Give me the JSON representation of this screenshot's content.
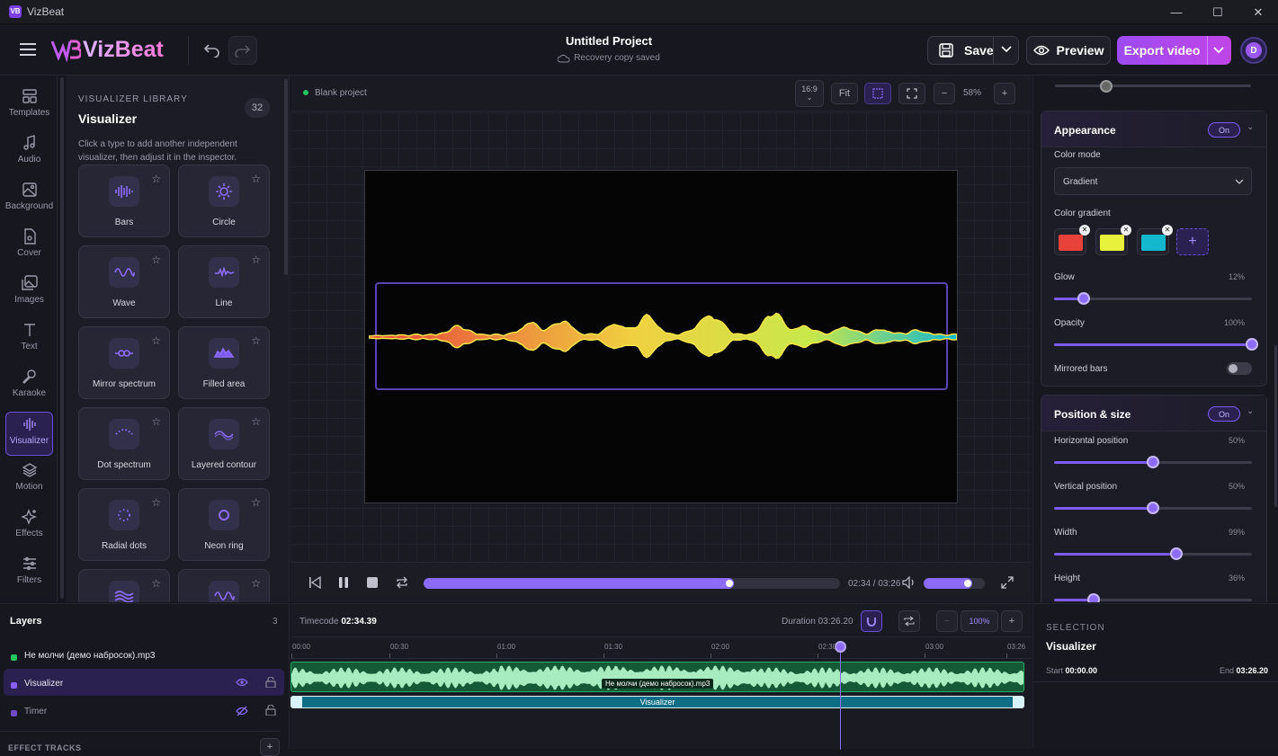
{
  "window": {
    "title": "VizBeat",
    "logo_text": "VB"
  },
  "header": {
    "brand": "VizBeat",
    "project_title": "Untitled Project",
    "project_status": "Recovery copy saved",
    "save_label": "Save",
    "preview_label": "Preview",
    "export_label": "Export video",
    "avatar_initial": "D"
  },
  "rail": {
    "items": [
      {
        "label": "Templates",
        "icon": "templates-icon"
      },
      {
        "label": "Audio",
        "icon": "music-note-icon"
      },
      {
        "label": "Background",
        "icon": "image-icon"
      },
      {
        "label": "Cover",
        "icon": "cover-icon"
      },
      {
        "label": "Images",
        "icon": "images-icon"
      },
      {
        "label": "Text",
        "icon": "text-icon"
      },
      {
        "label": "Karaoke",
        "icon": "microphone-icon"
      },
      {
        "label": "Visualizer",
        "icon": "waveform-icon",
        "active": true
      },
      {
        "label": "Motion",
        "icon": "layers-icon"
      },
      {
        "label": "Effects",
        "icon": "sparkle-icon"
      },
      {
        "label": "Filters",
        "icon": "sliders-icon"
      }
    ]
  },
  "library": {
    "kicker": "VISUALIZER LIBRARY",
    "title": "Visualizer",
    "count": "32",
    "hint": "Click a type to add another independent visualizer, then adjust it in the inspector.",
    "cards": [
      {
        "label": "Bars",
        "icon": "bars-icon"
      },
      {
        "label": "Circle",
        "icon": "sun-icon"
      },
      {
        "label": "Wave",
        "icon": "wave-icon"
      },
      {
        "label": "Line",
        "icon": "line-wave-icon"
      },
      {
        "label": "Mirror spectrum",
        "icon": "mirror-icon"
      },
      {
        "label": "Filled area",
        "icon": "area-icon"
      },
      {
        "label": "Dot spectrum",
        "icon": "dots-arc-icon"
      },
      {
        "label": "Layered contour",
        "icon": "contour-icon"
      },
      {
        "label": "Radial dots",
        "icon": "radial-dots-icon"
      },
      {
        "label": "Neon ring",
        "icon": "ring-icon"
      },
      {
        "label": "",
        "icon": "stacked-wave-icon"
      },
      {
        "label": "",
        "icon": "wave-icon"
      }
    ]
  },
  "stage": {
    "project_label": "Blank project",
    "aspect": "16:9",
    "fit_label": "Fit",
    "zoom": "58%"
  },
  "player": {
    "time_display": "02:34 / 03:26",
    "progress": 0.745,
    "volume": 0.8
  },
  "inspector": {
    "appearance": {
      "title": "Appearance",
      "toggle": "On",
      "color_mode_label": "Color mode",
      "color_mode_value": "Gradient",
      "gradient_label": "Color gradient",
      "colors": [
        "#e8423a",
        "#e8f23c",
        "#13b8cf"
      ],
      "glow_label": "Glow",
      "glow_value": "12%",
      "glow": 0.12,
      "opacity_label": "Opacity",
      "opacity_value": "100%",
      "opacity": 1.0,
      "mirrored_label": "Mirrored bars"
    },
    "position": {
      "title": "Position & size",
      "toggle": "On",
      "h_label": "Horizontal position",
      "h_value": "50%",
      "h": 0.5,
      "v_label": "Vertical position",
      "v_value": "50%",
      "v": 0.5,
      "w_label": "Width",
      "w_value": "99%",
      "w": 0.62,
      "ht_label": "Height",
      "ht_value": "36%",
      "ht": 0.2
    }
  },
  "layers": {
    "title": "Layers",
    "count": "3",
    "items": [
      {
        "name": "Не молчи (демо набросок).mp3",
        "color": "#22c55e"
      },
      {
        "name": "Visualizer",
        "color": "#8b5cf6"
      },
      {
        "name": "Timer",
        "color": "#6d4bc7"
      }
    ],
    "effect_tracks_label": "EFFECT TRACKS"
  },
  "timeline": {
    "timecode_label": "Timecode",
    "timecode": "02:34.39",
    "duration_label": "Duration",
    "duration": "03:26.20",
    "zoom": "100%",
    "ticks": [
      "00:00",
      "00:30",
      "01:00",
      "01:30",
      "02:00",
      "02:30",
      "03:00",
      "03:26"
    ],
    "audio_clip": "Не молчи (демо набросок).mp3",
    "viz_clip": "Visualizer",
    "playhead_fraction": 0.749
  },
  "selection": {
    "kicker": "SELECTION",
    "name": "Visualizer",
    "start_label": "Start",
    "start": "00:00.00",
    "end_label": "End",
    "end": "03:26.20"
  }
}
